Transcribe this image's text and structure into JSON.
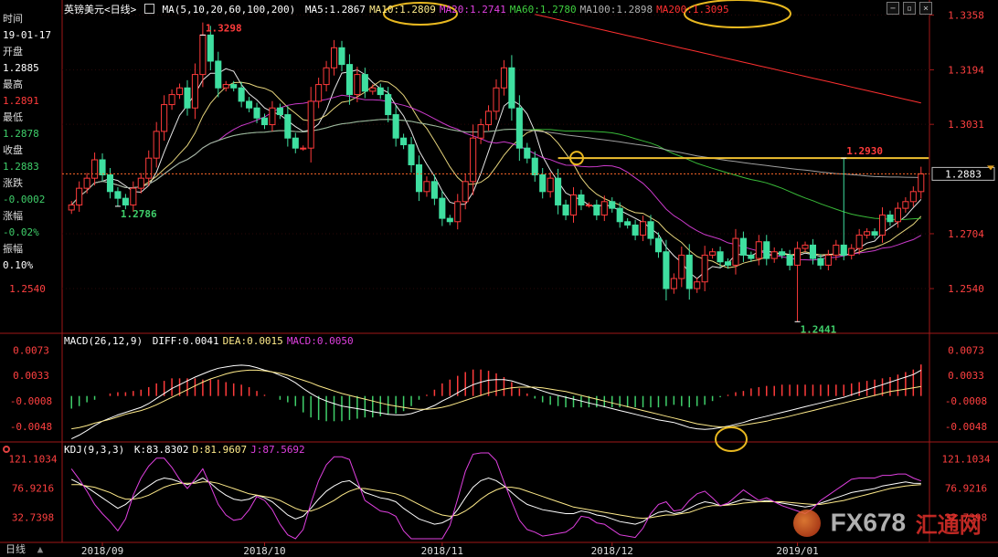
{
  "header": {
    "title": "英镑美元<日线>",
    "ma_label": "MA(5,10,20,60,100,200)",
    "ma_items": [
      {
        "label": "MA5:",
        "value": "1.2867",
        "color": "#ffffff"
      },
      {
        "label": "MA10:",
        "value": "1.2809",
        "color": "#ffeb8a"
      },
      {
        "label": "MA20:",
        "value": "1.2741",
        "color": "#e040e0"
      },
      {
        "label": "MA60:",
        "value": "1.2780",
        "color": "#3fcf3f"
      },
      {
        "label": "MA100:",
        "value": "1.2898",
        "color": "#b0b0b0"
      },
      {
        "label": "MA200:",
        "value": "1.3095",
        "color": "#ff3030"
      }
    ]
  },
  "info_panel": [
    {
      "label": "时间",
      "value": "19-01-17",
      "value_color": "#ffffff"
    },
    {
      "label": "开盘",
      "value": "1.2885",
      "value_color": "#ffffff"
    },
    {
      "label": "最高",
      "value": "1.2891",
      "value_color": "#ff3b3b"
    },
    {
      "label": "最低",
      "value": "1.2878",
      "value_color": "#3fcf6a"
    },
    {
      "label": "收盘",
      "value": "1.2883",
      "value_color": "#3fcf6a"
    },
    {
      "label": "涨跌",
      "value": "-0.0002",
      "value_color": "#3fcf6a"
    },
    {
      "label": "涨幅",
      "value": "-0.02%",
      "value_color": "#3fcf6a"
    },
    {
      "label": "振幅",
      "value": "0.10%",
      "value_color": "#ffffff"
    }
  ],
  "macd_header": {
    "label": "MACD(26,12,9)",
    "items": [
      {
        "label": "DIFF:",
        "value": "0.0041",
        "color": "#ffffff"
      },
      {
        "label": "DEA:",
        "value": "0.0015",
        "color": "#ffeb8a"
      },
      {
        "label": "MACD:",
        "value": "0.0050",
        "color": "#e040e0"
      }
    ]
  },
  "kdj_header": {
    "label": "KDJ(9,3,3)",
    "items": [
      {
        "label": "K:",
        "value": "83.8302",
        "color": "#ffffff"
      },
      {
        "label": "D:",
        "value": "81.9607",
        "color": "#ffeb8a"
      },
      {
        "label": "J:",
        "value": "87.5692",
        "color": "#e040e0"
      }
    ]
  },
  "bottom_bar": {
    "period_label": "日线"
  },
  "watermark": {
    "text": "FX678",
    "text2": "汇通网"
  },
  "colors": {
    "up": "#ff3b3b",
    "down": "#3fdfa0",
    "grid": "#a01818",
    "axis_text": "#ff4040",
    "level": "#f0c030",
    "highlight": "#e8b820",
    "price_line": "#ff6a2a"
  },
  "chart_data": [
    {
      "type": "candlestick",
      "name": "GBP/USD daily",
      "y_ticks": [
        "1.3358",
        "1.3194",
        "1.3031",
        "1.2704",
        "1.2540"
      ],
      "ylim": [
        1.242,
        1.337
      ],
      "x_labels": [
        "2018/09",
        "2018/10",
        "2018/11",
        "2018/12",
        "2019/01"
      ],
      "x_label_index": [
        4,
        25,
        48,
        70,
        94
      ],
      "current_price": "1.2883",
      "left_axis_label": "1.2540",
      "annotations": [
        {
          "text": "1.3298",
          "index": 17,
          "value": 1.3298,
          "color": "#ff3b3b",
          "position": "above"
        },
        {
          "text": "1.2786",
          "index": 6,
          "value": 1.2786,
          "color": "#3fcf6a",
          "position": "below"
        },
        {
          "text": "1.2441",
          "index": 94,
          "value": 1.2441,
          "color": "#3fcf6a",
          "position": "below"
        },
        {
          "text": "1.2930",
          "index": 100,
          "value": 1.293,
          "color": "#ff3b3b",
          "position": "above"
        }
      ],
      "horizontal_level": {
        "value": 1.293,
        "from_index": 63,
        "to_index": 111
      },
      "close": [
        1.279,
        1.284,
        1.287,
        1.2925,
        1.288,
        1.283,
        1.281,
        1.279,
        1.284,
        1.287,
        1.293,
        1.301,
        1.309,
        1.312,
        1.314,
        1.308,
        1.318,
        1.3298,
        1.322,
        1.314,
        1.315,
        1.314,
        1.31,
        1.308,
        1.305,
        1.303,
        1.308,
        1.306,
        1.299,
        1.296,
        1.296,
        1.31,
        1.315,
        1.32,
        1.326,
        1.321,
        1.312,
        1.318,
        1.313,
        1.314,
        1.312,
        1.306,
        1.299,
        1.297,
        1.291,
        1.283,
        1.286,
        1.281,
        1.275,
        1.274,
        1.28,
        1.286,
        1.299,
        1.303,
        1.307,
        1.314,
        1.32,
        1.308,
        1.296,
        1.293,
        1.288,
        1.283,
        1.287,
        1.279,
        1.276,
        1.282,
        1.279,
        1.279,
        1.276,
        1.28,
        1.278,
        1.274,
        1.273,
        1.27,
        1.274,
        1.269,
        1.265,
        1.254,
        1.257,
        1.264,
        1.254,
        1.256,
        1.264,
        1.265,
        1.262,
        1.261,
        1.269,
        1.264,
        1.263,
        1.268,
        1.263,
        1.265,
        1.264,
        1.261,
        1.266,
        1.267,
        1.263,
        1.261,
        1.264,
        1.267,
        1.264,
        1.266,
        1.27,
        1.271,
        1.27,
        1.276,
        1.274,
        1.278,
        1.28,
        1.283,
        1.2883
      ]
    },
    {
      "type": "bar+line",
      "name": "MACD",
      "y_ticks": [
        "0.0073",
        "0.0033",
        "-0.0008",
        "-0.0048"
      ],
      "ylim": [
        -0.007,
        0.0085
      ],
      "diff": [
        -0.0068,
        -0.0062,
        -0.0055,
        -0.0047,
        -0.004,
        -0.0035,
        -0.003,
        -0.0026,
        -0.0022,
        -0.0018,
        -0.0012,
        -0.0004,
        0.0004,
        0.0012,
        0.0018,
        0.0024,
        0.003,
        0.0035,
        0.004,
        0.0044,
        0.0046,
        0.0048,
        0.0049,
        0.0048,
        0.0045,
        0.0041,
        0.0038,
        0.0033,
        0.0028,
        0.0021,
        0.0012,
        0.0004,
        -0.0003,
        -0.0008,
        -0.0012,
        -0.0016,
        -0.0018,
        -0.002,
        -0.0022,
        -0.0025,
        -0.0027,
        -0.0029,
        -0.003,
        -0.003,
        -0.0028,
        -0.0024,
        -0.002,
        -0.0015,
        -0.0008,
        -0.0002,
        0.0005,
        0.0012,
        0.0018,
        0.0022,
        0.0025,
        0.0026,
        0.0026,
        0.0024,
        0.002,
        0.0016,
        0.0012,
        0.0008,
        0.0004,
        0.0001,
        -0.0002,
        -0.0005,
        -0.0008,
        -0.0011,
        -0.0014,
        -0.0017,
        -0.002,
        -0.0023,
        -0.0026,
        -0.0029,
        -0.0032,
        -0.0035,
        -0.0038,
        -0.004,
        -0.0042,
        -0.0046,
        -0.005,
        -0.0052,
        -0.0053,
        -0.0052,
        -0.005,
        -0.0048,
        -0.0045,
        -0.0042,
        -0.0038,
        -0.0035,
        -0.0032,
        -0.0029,
        -0.0026,
        -0.0023,
        -0.002,
        -0.0017,
        -0.0014,
        -0.0011,
        -0.0008,
        -0.0005,
        -0.0002,
        0.0002,
        0.0006,
        0.001,
        0.0014,
        0.0018,
        0.0022,
        0.0026,
        0.003,
        0.0034,
        0.0041
      ],
      "dea": [
        -0.0052,
        -0.005,
        -0.0047,
        -0.0043,
        -0.004,
        -0.0037,
        -0.0033,
        -0.0029,
        -0.0026,
        -0.0023,
        -0.0019,
        -0.0014,
        -0.0008,
        -0.0002,
        0.0004,
        0.001,
        0.0016,
        0.0022,
        0.0027,
        0.0031,
        0.0035,
        0.0038,
        0.004,
        0.0041,
        0.0041,
        0.004,
        0.0038,
        0.0036,
        0.0033,
        0.0029,
        0.0025,
        0.0021,
        0.0016,
        0.0012,
        0.0008,
        0.0004,
        0.0001,
        -0.0002,
        -0.0005,
        -0.0008,
        -0.0011,
        -0.0014,
        -0.0016,
        -0.0018,
        -0.002,
        -0.0021,
        -0.0021,
        -0.002,
        -0.0018,
        -0.0015,
        -0.0011,
        -0.0007,
        -0.0003,
        0.0001,
        0.0005,
        0.0008,
        0.0011,
        0.0013,
        0.0014,
        0.0014,
        0.0014,
        0.0013,
        0.0011,
        0.0009,
        0.0007,
        0.0004,
        0.0001,
        -0.0002,
        -0.0005,
        -0.0008,
        -0.0011,
        -0.0014,
        -0.0017,
        -0.002,
        -0.0023,
        -0.0026,
        -0.0029,
        -0.0032,
        -0.0035,
        -0.0038,
        -0.0041,
        -0.0044,
        -0.0046,
        -0.0048,
        -0.0049,
        -0.0049,
        -0.0048,
        -0.0046,
        -0.0044,
        -0.0042,
        -0.004,
        -0.0037,
        -0.0035,
        -0.0032,
        -0.0029,
        -0.0026,
        -0.0023,
        -0.002,
        -0.0017,
        -0.0014,
        -0.0011,
        -0.0008,
        -0.0005,
        -0.0002,
        0.0001,
        0.0004,
        0.0007,
        0.0009,
        0.0011,
        0.0013,
        0.0015
      ],
      "macd": [
        -0.002,
        -0.0016,
        -0.001,
        -0.0006,
        0.0,
        0.0004,
        0.0006,
        0.0006,
        0.0008,
        0.001,
        0.0014,
        0.002,
        0.0024,
        0.0028,
        0.0028,
        0.0028,
        0.0028,
        0.0026,
        0.0026,
        0.0026,
        0.0022,
        0.002,
        0.0018,
        0.0014,
        0.0008,
        0.0002,
        0.0,
        -0.0006,
        -0.001,
        -0.0016,
        -0.0026,
        -0.0034,
        -0.0038,
        -0.004,
        -0.004,
        -0.004,
        -0.0038,
        -0.0036,
        -0.0034,
        -0.0034,
        -0.0032,
        -0.003,
        -0.0028,
        -0.0024,
        -0.0016,
        -0.0006,
        0.0002,
        0.001,
        0.002,
        0.0026,
        0.0032,
        0.0038,
        0.0042,
        0.0042,
        0.004,
        0.0036,
        0.003,
        0.0022,
        0.0012,
        0.0004,
        -0.0004,
        -0.001,
        -0.0014,
        -0.0016,
        -0.0018,
        -0.0018,
        -0.0018,
        -0.0018,
        -0.0018,
        -0.0018,
        -0.0018,
        -0.0018,
        -0.0018,
        -0.0018,
        -0.0018,
        -0.0018,
        -0.0018,
        -0.0016,
        -0.0014,
        -0.0016,
        -0.0018,
        -0.0016,
        -0.0014,
        -0.0008,
        -0.0002,
        0.0002,
        0.0006,
        0.0008,
        0.0012,
        0.0014,
        0.0016,
        0.0016,
        0.0018,
        0.0018,
        0.0018,
        0.0018,
        0.0018,
        0.0018,
        0.0018,
        0.0018,
        0.0018,
        0.002,
        0.0022,
        0.0024,
        0.0026,
        0.0028,
        0.003,
        0.0034,
        0.0038,
        0.0042,
        0.005
      ]
    },
    {
      "type": "line",
      "name": "KDJ",
      "y_ticks": [
        "121.1034",
        "76.9216",
        "32.7398"
      ],
      "ylim": [
        0,
        130
      ],
      "k": [
        90,
        84,
        78,
        70,
        62,
        54,
        46,
        52,
        62,
        72,
        80,
        88,
        92,
        90,
        86,
        82,
        86,
        92,
        84,
        74,
        66,
        60,
        58,
        60,
        66,
        62,
        56,
        46,
        36,
        30,
        34,
        46,
        60,
        72,
        80,
        86,
        88,
        80,
        70,
        66,
        62,
        60,
        56,
        46,
        38,
        30,
        26,
        22,
        24,
        30,
        44,
        62,
        78,
        88,
        92,
        88,
        80,
        70,
        60,
        52,
        48,
        44,
        42,
        40,
        38,
        38,
        42,
        40,
        36,
        34,
        30,
        26,
        24,
        22,
        26,
        34,
        40,
        42,
        38,
        40,
        46,
        52,
        56,
        54,
        50,
        52,
        56,
        60,
        58,
        56,
        58,
        56,
        54,
        52,
        50,
        48,
        50,
        54,
        58,
        62,
        66,
        70,
        72,
        74,
        76,
        80,
        82,
        84,
        86,
        84,
        83.83
      ],
      "d": [
        82,
        82,
        80,
        78,
        74,
        70,
        64,
        60,
        60,
        62,
        66,
        72,
        78,
        82,
        84,
        84,
        84,
        86,
        86,
        84,
        80,
        76,
        72,
        68,
        66,
        64,
        62,
        58,
        52,
        46,
        42,
        42,
        46,
        52,
        58,
        66,
        72,
        76,
        76,
        74,
        72,
        70,
        68,
        64,
        58,
        52,
        46,
        40,
        36,
        34,
        36,
        42,
        50,
        60,
        68,
        74,
        78,
        78,
        76,
        72,
        68,
        64,
        60,
        56,
        52,
        48,
        46,
        44,
        42,
        40,
        38,
        36,
        34,
        32,
        31,
        32,
        34,
        36,
        36,
        38,
        40,
        44,
        48,
        50,
        50,
        51,
        52,
        54,
        55,
        56,
        56,
        56,
        56,
        55,
        54,
        53,
        52,
        52,
        54,
        56,
        58,
        61,
        64,
        67,
        70,
        73,
        76,
        78,
        80,
        81,
        81.96
      ],
      "j": [
        106,
        90,
        72,
        52,
        38,
        26,
        12,
        30,
        66,
        92,
        110,
        122,
        122,
        108,
        90,
        76,
        90,
        106,
        80,
        52,
        36,
        28,
        30,
        44,
        64,
        58,
        44,
        22,
        6,
        0,
        14,
        54,
        88,
        112,
        124,
        124,
        120,
        88,
        58,
        50,
        42,
        40,
        34,
        12,
        0,
        0,
        0,
        0,
        0,
        20,
        60,
        102,
        128,
        130,
        130,
        118,
        86,
        56,
        28,
        14,
        10,
        4,
        6,
        8,
        10,
        18,
        34,
        32,
        24,
        22,
        14,
        6,
        4,
        2,
        16,
        38,
        52,
        56,
        42,
        44,
        58,
        68,
        72,
        62,
        50,
        54,
        64,
        74,
        66,
        58,
        62,
        56,
        50,
        46,
        42,
        38,
        46,
        58,
        66,
        74,
        82,
        90,
        92,
        92,
        92,
        96,
        96,
        98,
        98,
        92,
        87.57
      ]
    }
  ]
}
